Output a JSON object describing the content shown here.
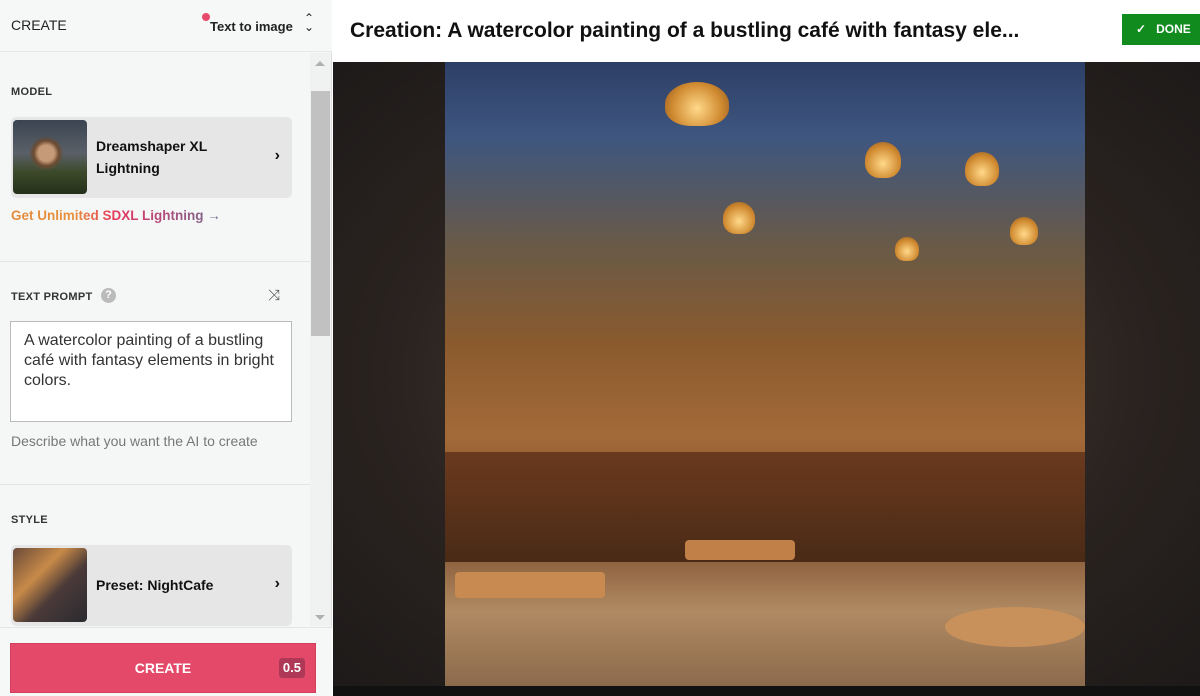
{
  "sidebar": {
    "header_label": "CREATE",
    "mode_selector": "Text to image",
    "model": {
      "section": "MODEL",
      "name_line1": "Dreamshaper XL",
      "name_line2": "Lightning",
      "promo": "Get Unlimited SDXL Lightning →"
    },
    "prompt": {
      "section": "TEXT PROMPT",
      "value": "A watercolor painting of a bustling café with fantasy elements in bright colors.",
      "hint": "Describe what you want the AI to create"
    },
    "style": {
      "section": "STYLE",
      "name": "Preset: NightCafe"
    },
    "create_button": "CREATE",
    "cost": "0.5"
  },
  "header": {
    "title": "Creation: A watercolor painting of a bustling café with fantasy ele...",
    "done_label": "DONE"
  },
  "colors": {
    "accent": "#e5496a",
    "done": "#118a1e"
  },
  "icons": {
    "mode": "chevron-up-down-icon",
    "card": "chevron-right-icon",
    "help": "question-icon",
    "shuffle": "shuffle-icon",
    "done": "check-icon"
  }
}
